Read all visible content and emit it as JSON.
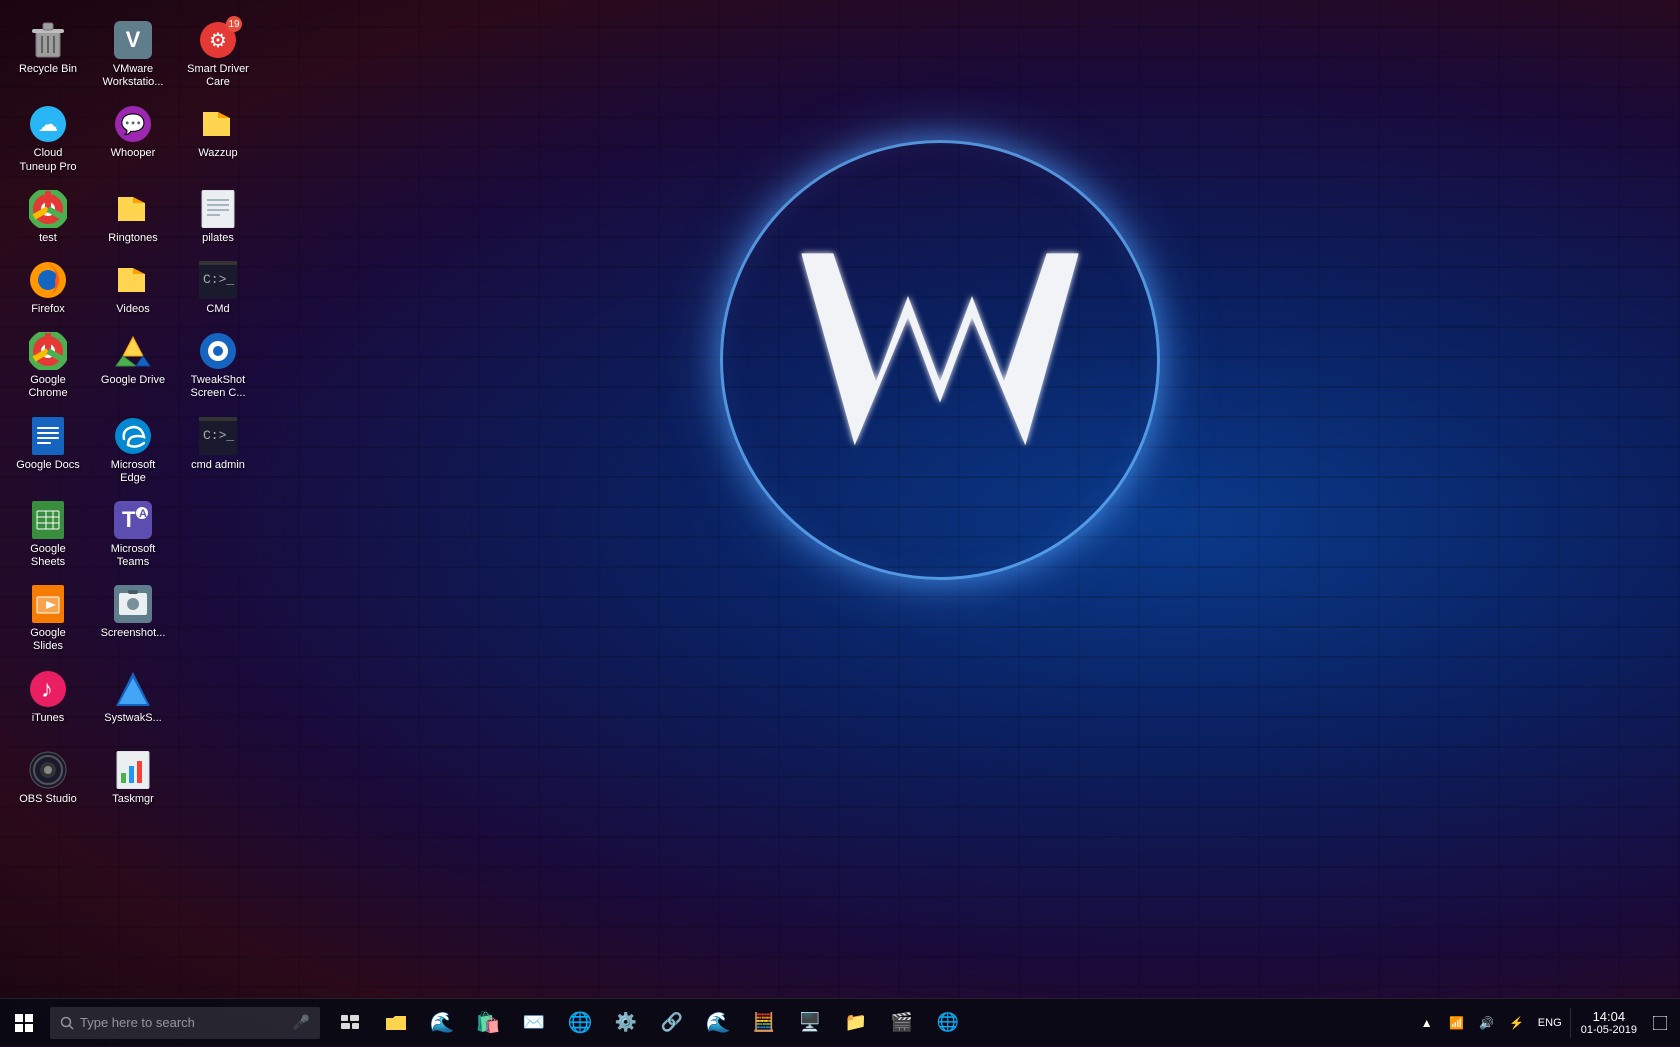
{
  "desktop": {
    "icons": [
      {
        "id": "recycle-bin",
        "label": "Recycle Bin",
        "emoji": "🗑️",
        "color": "#888",
        "row": 0,
        "col": 0
      },
      {
        "id": "vmware",
        "label": "VMware Workstatio...",
        "emoji": "🖥️",
        "color": "#607D8B",
        "row": 0,
        "col": 1
      },
      {
        "id": "smart-driver",
        "label": "Smart Driver Care",
        "emoji": "⚙️",
        "color": "#f44336",
        "badge": "19",
        "row": 0,
        "col": 2
      },
      {
        "id": "cloud-tuneup",
        "label": "Cloud Tuneup Pro",
        "emoji": "☁️",
        "color": "#29b6f6",
        "row": 1,
        "col": 0
      },
      {
        "id": "whooper",
        "label": "Whooper",
        "emoji": "💬",
        "color": "#9c27b0",
        "row": 1,
        "col": 1
      },
      {
        "id": "wazzup",
        "label": "Wazzup",
        "emoji": "📁",
        "color": "#ffd54f",
        "row": 1,
        "col": 2
      },
      {
        "id": "test",
        "label": "test",
        "emoji": "🌐",
        "color": "#e53935",
        "row": 2,
        "col": 0
      },
      {
        "id": "ringtones",
        "label": "Ringtones",
        "emoji": "📁",
        "color": "#ffd54f",
        "row": 2,
        "col": 1
      },
      {
        "id": "pilates",
        "label": "pilates",
        "emoji": "📄",
        "color": "#78909c",
        "row": 2,
        "col": 2
      },
      {
        "id": "firefox",
        "label": "Firefox",
        "emoji": "🦊",
        "color": "#ff7043",
        "row": 3,
        "col": 0
      },
      {
        "id": "videos",
        "label": "Videos",
        "emoji": "📁",
        "color": "#ffd54f",
        "row": 3,
        "col": 1
      },
      {
        "id": "cmd",
        "label": "CMd",
        "emoji": "⬛",
        "color": "#333",
        "row": 3,
        "col": 2
      },
      {
        "id": "google-chrome",
        "label": "Google Chrome",
        "emoji": "🌐",
        "color": "#e53935",
        "row": 4,
        "col": 0
      },
      {
        "id": "google-drive",
        "label": "Google Drive",
        "emoji": "△",
        "color": "#ffd54f",
        "row": 4,
        "col": 1
      },
      {
        "id": "tweakshot",
        "label": "TweakShot Screen C...",
        "emoji": "📷",
        "color": "#1565c0",
        "row": 4,
        "col": 2
      },
      {
        "id": "google-docs",
        "label": "Google Docs",
        "emoji": "📘",
        "color": "#1565c0",
        "row": 5,
        "col": 0
      },
      {
        "id": "microsoft-edge",
        "label": "Microsoft Edge",
        "emoji": "🌊",
        "color": "#0288d1",
        "row": 5,
        "col": 1
      },
      {
        "id": "cmd-admin",
        "label": "cmd admin",
        "emoji": "⬛",
        "color": "#333",
        "row": 5,
        "col": 2
      },
      {
        "id": "google-sheets",
        "label": "Google Sheets",
        "emoji": "📗",
        "color": "#388e3c",
        "row": 6,
        "col": 0
      },
      {
        "id": "microsoft-teams",
        "label": "Microsoft Teams",
        "emoji": "👥",
        "color": "#5c4db1",
        "row": 6,
        "col": 1
      },
      {
        "id": "google-slides",
        "label": "Google Slides",
        "emoji": "📙",
        "color": "#f57c00",
        "row": 7,
        "col": 0
      },
      {
        "id": "screenshots",
        "label": "Screenshot...",
        "emoji": "🖼️",
        "color": "#607D8B",
        "row": 7,
        "col": 1
      },
      {
        "id": "itunes",
        "label": "iTunes",
        "emoji": "🎵",
        "color": "#e91e63",
        "row": 8,
        "col": 0
      },
      {
        "id": "systweak",
        "label": "SystwakS...",
        "emoji": "🔷",
        "color": "#1565c0",
        "row": 8,
        "col": 1
      },
      {
        "id": "obs",
        "label": "OBS Studio",
        "emoji": "⭕",
        "color": "#333",
        "row": 9,
        "col": 0
      },
      {
        "id": "taskmgr",
        "label": "Taskmgr",
        "emoji": "📊",
        "color": "#78909c",
        "row": 9,
        "col": 1
      }
    ]
  },
  "taskbar": {
    "search_placeholder": "Type here to search",
    "time": "14:04",
    "date": "01-05-2019",
    "language": "ENG",
    "icons": [
      {
        "id": "task-view",
        "emoji": "⧉"
      },
      {
        "id": "file-explorer",
        "emoji": "📁"
      },
      {
        "id": "edge",
        "emoji": "🌊"
      },
      {
        "id": "store",
        "emoji": "🛍️"
      },
      {
        "id": "mail",
        "emoji": "✉️"
      },
      {
        "id": "chrome",
        "emoji": "🌐"
      },
      {
        "id": "task2",
        "emoji": "⚙️"
      },
      {
        "id": "settings",
        "emoji": "🔗"
      },
      {
        "id": "edge2",
        "emoji": "🌊"
      },
      {
        "id": "calc",
        "emoji": "🧮"
      },
      {
        "id": "remote",
        "emoji": "🖥️"
      },
      {
        "id": "explorer2",
        "emoji": "📁"
      },
      {
        "id": "media",
        "emoji": "🎬"
      },
      {
        "id": "globe",
        "emoji": "🌐"
      }
    ]
  },
  "logo": {
    "alt": "Winstep W logo"
  }
}
